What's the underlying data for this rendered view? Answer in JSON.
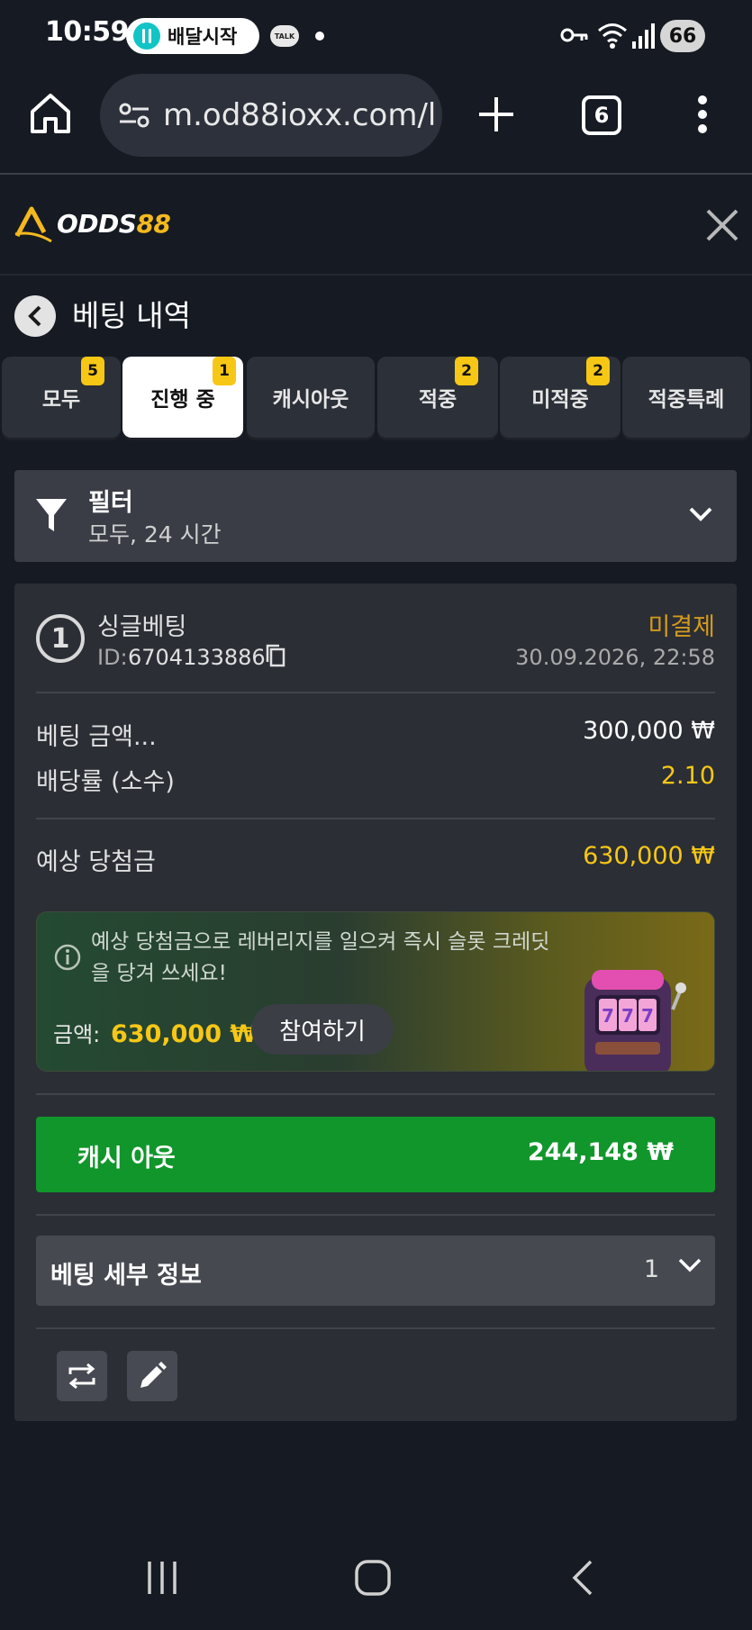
{
  "status_bar": {
    "time": "10:59",
    "delivery_app": "배달시작",
    "talk": "TALK",
    "battery": "66"
  },
  "browser": {
    "url": "m.od88ioxx.com/l",
    "tab_count": "6"
  },
  "site": {
    "logo_prefix": "ODDS",
    "logo_number": "88"
  },
  "page": {
    "title": "베팅 내역"
  },
  "tabs": [
    {
      "label": "모두",
      "badge": "5"
    },
    {
      "label": "진행 중",
      "badge": "1",
      "active": true
    },
    {
      "label": "캐시아웃",
      "badge": ""
    },
    {
      "label": "적중",
      "badge": "2"
    },
    {
      "label": "미적중",
      "badge": "2"
    },
    {
      "label": "적중특례",
      "badge": ""
    }
  ],
  "filter": {
    "title": "필터",
    "subtitle": "모두, 24 시간"
  },
  "bet": {
    "number": "1",
    "type": "싱글베팅",
    "id_label": "ID:",
    "id": "6704133886",
    "status": "미결제",
    "date": "30.09.2026, 22:58",
    "stake_label": "베팅 금액...",
    "stake_value": "300,000 ₩",
    "odds_label": "배당률 (소수)",
    "odds_value": "2.10",
    "payout_label": "예상 당첨금",
    "payout_value": "630,000 ₩"
  },
  "promo": {
    "text": "예상 당첨금으로 레버리지를 일으켜 즉시 슬롯 크레딧을 당겨 쓰세요!",
    "amount_label": "금액:",
    "amount_value": "630,000 ₩",
    "button": "참여하기"
  },
  "cashout": {
    "label": "캐시 아웃",
    "amount": "244,148 ₩"
  },
  "details": {
    "label": "베팅 세부 정보",
    "count": "1"
  },
  "colors": {
    "background": "#161a22",
    "accent_yellow": "#f7c715",
    "status_orange": "#d49a1d",
    "cashout_green": "#11962b"
  }
}
